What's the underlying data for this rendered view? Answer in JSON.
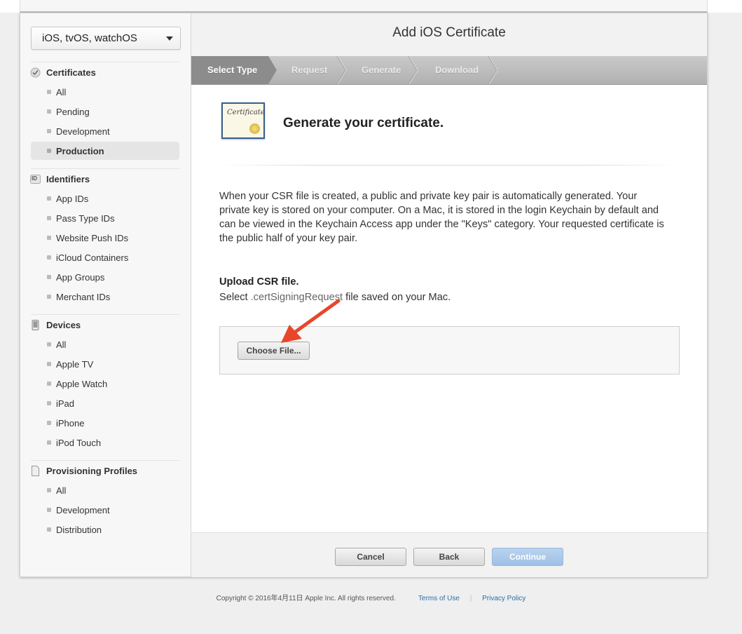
{
  "sidebar": {
    "platform_select": "iOS, tvOS, watchOS",
    "certificates": {
      "title": "Certificates",
      "items": [
        "All",
        "Pending",
        "Development",
        "Production"
      ],
      "active": "Production"
    },
    "identifiers": {
      "title": "Identifiers",
      "icon_text": "ID",
      "items": [
        "App IDs",
        "Pass Type IDs",
        "Website Push IDs",
        "iCloud Containers",
        "App Groups",
        "Merchant IDs"
      ]
    },
    "devices": {
      "title": "Devices",
      "items": [
        "All",
        "Apple TV",
        "Apple Watch",
        "iPad",
        "iPhone",
        "iPod Touch"
      ]
    },
    "provisioning": {
      "title": "Provisioning Profiles",
      "items": [
        "All",
        "Development",
        "Distribution"
      ]
    }
  },
  "main": {
    "title": "Add iOS Certificate",
    "steps": [
      "Select Type",
      "Request",
      "Generate",
      "Download"
    ],
    "current_step": "Select Type",
    "cert_icon_text": "Certificate",
    "heading": "Generate your certificate.",
    "description": "When your CSR file is created, a public and private key pair is automatically generated. Your private key is stored on your computer. On a Mac, it is stored in the login Keychain by default and can be viewed in the Keychain Access app under the \"Keys\" category. Your requested certificate is the public half of your key pair.",
    "upload_title": "Upload CSR file.",
    "upload_sub_prefix": "Select ",
    "upload_sub_ext": ".certSigningRequest",
    "upload_sub_suffix": " file saved on your Mac.",
    "choose_file": "Choose File...",
    "buttons": {
      "cancel": "Cancel",
      "back": "Back",
      "continue": "Continue"
    }
  },
  "footer": {
    "copyright": "Copyright © 2016年4月11日 Apple Inc. All rights reserved.",
    "terms": "Terms of Use",
    "privacy": "Privacy Policy"
  },
  "colors": {
    "annotation_arrow": "#e8462a",
    "continue_button": "#a9c6ea",
    "link": "#2b6ea8"
  }
}
